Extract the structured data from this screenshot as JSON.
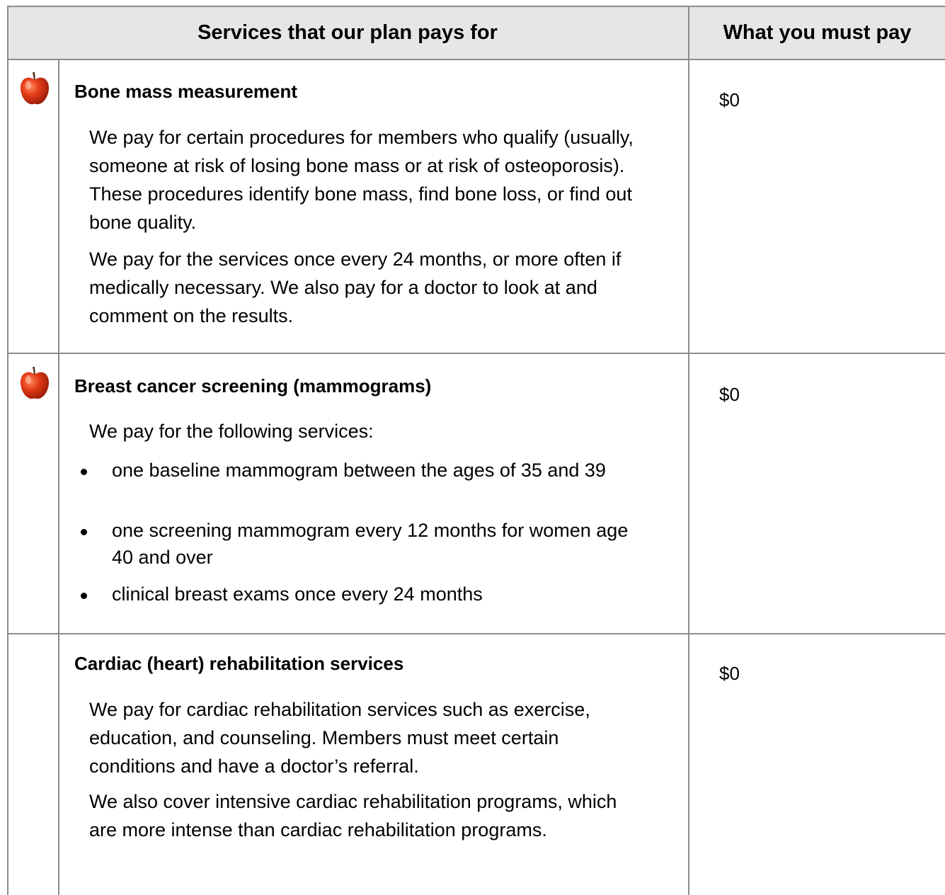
{
  "header": {
    "col1": "Services that our plan pays for",
    "col2": "What you must pay"
  },
  "rows": [
    {
      "icon": "apple-icon",
      "title": "Bone mass measurement",
      "price": "$0",
      "paragraphs": [
        "We pay for certain procedures for members who qualify (usually, someone at risk of losing bone mass or at risk of osteoporosis). These procedures identify bone mass, find bone loss, or find out bone quality.",
        "We pay for the services once every 24 months, or more often if medically necessary. We also pay for a doctor to look at and comment on the results."
      ]
    },
    {
      "icon": "apple-icon",
      "title": "Breast cancer screening (mammograms)",
      "price": "$0",
      "intro": "We pay for the following services:",
      "bullets": [
        "one baseline mammogram between the ages of 35 and 39",
        "one screening mammogram every 12 months for women age 40 and over",
        "clinical breast exams once every 24 months"
      ]
    },
    {
      "title": "Cardiac (heart) rehabilitation services",
      "price": "$0",
      "paragraphs": [
        "We pay for cardiac rehabilitation services such as exercise, education, and counseling. Members must meet certain conditions and have a doctor’s referral.",
        "We also cover intensive cardiac rehabilitation programs, which are more intense than cardiac rehabilitation programs."
      ]
    }
  ],
  "colors": {
    "header_bg": "#e6e6e6",
    "border": "#8c8c8c",
    "apple_red": "#d8341c"
  }
}
